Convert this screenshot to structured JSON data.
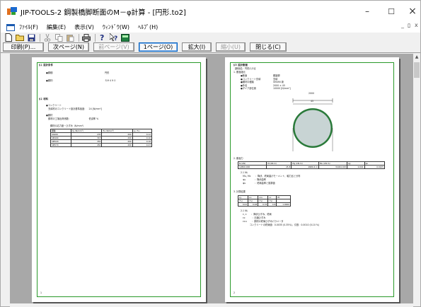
{
  "window": {
    "title": "JIP-TOOLS-2 鋼製橋脚断面のM－φ計算 - [円形.to2]",
    "minimize_glyph": "–",
    "maximize_glyph": "☐",
    "close_glyph": "×",
    "mdi_min": "_",
    "mdi_restore": "ﾛ",
    "mdi_close": "x"
  },
  "menu": {
    "items": [
      "ﾌｧｲﾙ(F)",
      "編集(E)",
      "表示(V)",
      "ｳｨﾝﾄﾞｳ(W)",
      "ﾍﾙﾌﾟ(H)"
    ]
  },
  "toolbar": {
    "icons": [
      "new-file-icon",
      "open-folder-icon",
      "save-icon",
      "cut-icon",
      "copy-icon",
      "paste-icon",
      "print-icon",
      "help-icon",
      "context-help-icon",
      "calc-icon"
    ]
  },
  "nav": {
    "print": "印刷(P)...",
    "next": "次ページ(N)",
    "prev": "前ページ(V)",
    "onepage": "1ページ(O)",
    "zoomin": "拡大(I)",
    "zoomout": "縮小(U)",
    "close": "閉じる(C)"
  },
  "page1": {
    "s1_title": "§１ 設計条件",
    "s1_l1": "●鋼種：",
    "s1_v1": "円形",
    "s1_l2": "●鋼材：",
    "s1_v2": "ＳＭ４９０",
    "s2_title": "§２ 材料",
    "s2_l1": "●コンクリート",
    "s2_l2": "　充填材のコンクリート設計基準強度：　24 [N/mm²]",
    "s2_l3": "●鋼材",
    "s2_l4": "　鋼材の工場出荷係数：　　　　　　　　低減率 %",
    "tbl_title": "鋼材の応力度－ひずみ（N/mm²）",
    "tbl_head": [
      "鋼種",
      "σy (N/mm²)",
      "Es (N/mm²)",
      "εy (%)"
    ],
    "tbl_rows": [
      [
        "SS400",
        "235",
        "200",
        "0.12"
      ],
      [
        "SM490",
        "315",
        "200",
        "0.16"
      ],
      [
        "SM520",
        "355",
        "200",
        "0.18"
      ],
      [
        "SM570",
        "450",
        "200",
        "0.23"
      ]
    ],
    "footer": "1"
  },
  "page2": {
    "s3_title": "§３ 設計断面",
    "s3_sub": "【断面名：円形(1/2)】",
    "s3_h1": "1. 断面諸元",
    "r1l": "●断面",
    "r1v": "鋼製脚",
    "r2l": "●コンクリート充填",
    "r2v": "充填",
    "r3l": "●鋼材の種類",
    "r3v": "SM490 新",
    "r4l": "●外径",
    "r4v": "2000 × 45",
    "r5l": "●ダイア部位置",
    "r5v": "10000 [N/mm²]",
    "dim_top": "2000",
    "dim_sub": "45",
    "s3_h2": "2. 断面力",
    "tbl1": [
      "N (kN)",
      "M (kN·m)",
      "My (kN·m)",
      "Mu (kN·m)",
      "φy",
      "φu"
    ],
    "tbl1v": [
      "12800.000",
      "45.8",
      "9989.4 m",
      "31004.015",
      "0.004",
      "0.0105"
    ],
    "n1": "2.1 NL",
    "n2": "　Mu, Mc　　：降伏、終局曲げモーメント、軸力比と分布",
    "n3": "　ψy　　　　：降伏曲率",
    "n4": "　φu　　　　：終局曲率と換算値",
    "s3_h3": "3. 計算結果",
    "tbl2h": [
      "εy",
      "εu",
      "εcu",
      "εc",
      "Et"
    ],
    "tbl2u": [
      "(%)",
      "(%)",
      "(%)",
      "(%)",
      ""
    ],
    "tbl2v": [
      "0.02",
      "0.08",
      "0.35",
      "0.8",
      "1.0000"
    ],
    "m1": "2.1 NL",
    "m2": "　ε, ε　　：降伏ひずみ、終局",
    "m3": "　εc　　　：圧縮ひずみ",
    "m4": "　εcu　　 ：鋼材の終局ひずみパラメータ",
    "m5": "　　　　コンクリートの終局値：0.0035 (0.35%)、引張：0.0010 (0.10 %)",
    "footer": "2"
  }
}
